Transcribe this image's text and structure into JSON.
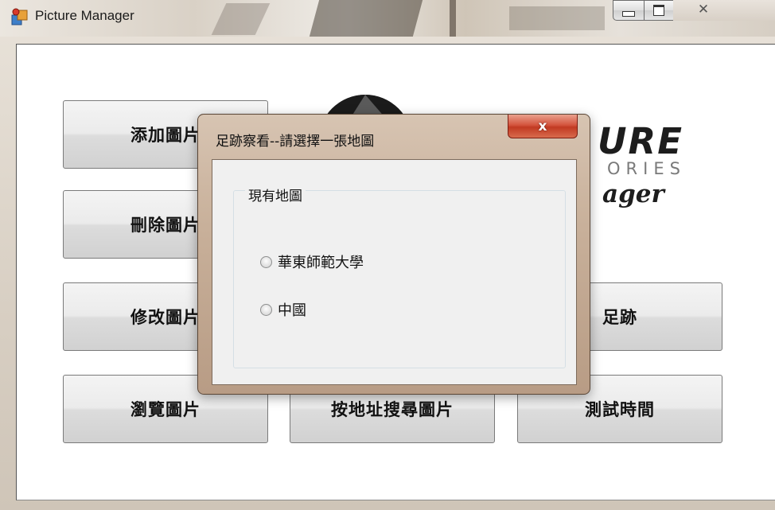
{
  "window": {
    "title": "Picture Manager",
    "controls": {
      "minimize": "minimize-icon",
      "maximize": "maximize-icon",
      "close": "close-icon"
    }
  },
  "main": {
    "buttons": [
      {
        "id": "add",
        "label": "添加圖片"
      },
      {
        "id": "delete",
        "label": "刪除圖片"
      },
      {
        "id": "edit",
        "label": "修改圖片"
      },
      {
        "id": "footprint",
        "label": "足跡"
      },
      {
        "id": "browse",
        "label": "瀏覽圖片"
      },
      {
        "id": "search-by-address",
        "label": "按地址搜尋圖片"
      },
      {
        "id": "test-time",
        "label": "測試時間"
      }
    ],
    "logo": {
      "line1": "URE",
      "line2": "ORIES",
      "line3": "ager"
    }
  },
  "dialog": {
    "title": "足跡察看--請選擇一張地圖",
    "close_label": "x",
    "group_title": "現有地圖",
    "options": [
      {
        "label": "華東師範大學",
        "selected": false
      },
      {
        "label": "中國",
        "selected": false
      }
    ]
  },
  "colors": {
    "dialog_close": "#c13a22",
    "frame": "#d8cfc3"
  }
}
